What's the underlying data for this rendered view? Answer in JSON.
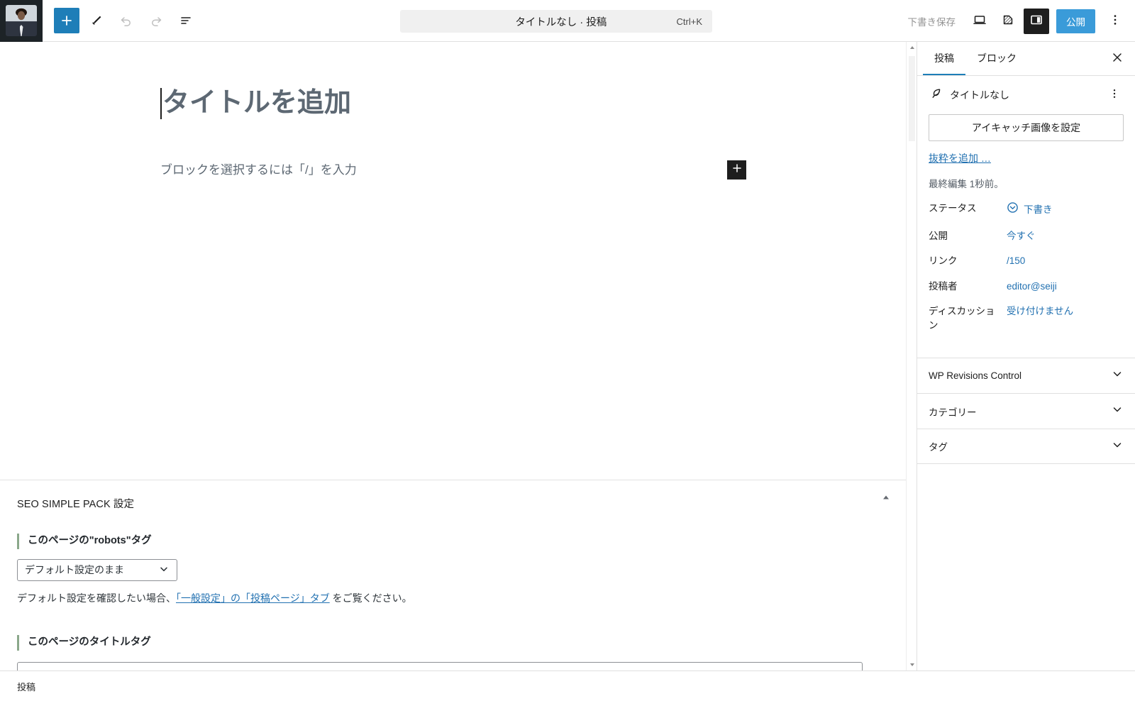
{
  "topbar": {
    "site_icon_name": "site-avatar-photo",
    "tools": [
      {
        "name": "block-inserter-toggle",
        "label": "ブロック挿入ツールを切り替え",
        "icon": "plus-icon",
        "state": "primary"
      },
      {
        "name": "edit-mode-tool",
        "label": "ツール",
        "icon": "pencil-icon",
        "state": "normal"
      },
      {
        "name": "undo-button",
        "label": "元に戻す",
        "icon": "undo-icon",
        "state": "disabled"
      },
      {
        "name": "redo-button",
        "label": "やり直す",
        "icon": "redo-icon",
        "state": "disabled"
      },
      {
        "name": "document-overview-button",
        "label": "ドキュメント概観",
        "icon": "list-view-icon",
        "state": "normal"
      }
    ],
    "command_bar": {
      "title": "タイトルなし · 投稿",
      "shortcut": "Ctrl+K"
    },
    "save_draft_label": "下書き保存",
    "right_tools": [
      {
        "name": "preview-button",
        "label": "プレビュー",
        "icon": "desktop-icon",
        "state": "normal"
      },
      {
        "name": "view-post-button",
        "label": "投稿を表示",
        "icon": "external-page-icon",
        "state": "normal"
      },
      {
        "name": "settings-sidebar-toggle",
        "label": "設定",
        "icon": "sidebar-panel-icon",
        "state": "active"
      }
    ],
    "publish_label": "公開",
    "options_label": "オプション",
    "options_icon": "three-dots-vertical-icon",
    "accent_color": "#1e7eb8",
    "publish_color": "#3a9bd9"
  },
  "editor": {
    "title_placeholder": "タイトルを追加",
    "block_placeholder": "ブロックを選択するには「/」を入力",
    "inserter_icon": "plus-icon"
  },
  "seo_box": {
    "title": "SEO SIMPLE PACK 設定",
    "collapse_icon": "triangle-up-icon",
    "robots_field": {
      "label_prefix": "このページの",
      "label_code": "\"robots\"",
      "label_suffix": "タグ",
      "select_value": "デフォルト設定のまま",
      "select_icon": "chevron-down-icon",
      "help_before": "デフォルト設定を確認したい場合、",
      "help_link": "「一般設定」の「投稿ページ」タブ",
      "help_after": " をご覧ください。"
    },
    "title_tag_field": {
      "label": "このページのタイトルタグ",
      "input_value": ""
    }
  },
  "scrollbar": {
    "up_icon": "triangle-up-icon",
    "down_icon": "triangle-down-icon"
  },
  "sidebar": {
    "tabs": [
      {
        "label": "投稿",
        "name": "tab-post",
        "selected": true
      },
      {
        "label": "ブロック",
        "name": "tab-block",
        "selected": false
      }
    ],
    "close_icon": "close-icon",
    "summary": {
      "post_icon": "feather-post-icon",
      "post_title": "タイトルなし",
      "more_icon": "three-dots-vertical-icon",
      "featured_image_label": "アイキャッチ画像を設定",
      "excerpt_link": "抜粋を追加 …",
      "last_edited": "最終編集 1秒前。"
    },
    "meta_rows": [
      {
        "name": "status-row",
        "label": "ステータス",
        "value": "下書き",
        "icon": "draft-circle-icon"
      },
      {
        "name": "publish-row",
        "label": "公開",
        "value": "今すぐ",
        "icon": ""
      },
      {
        "name": "link-row",
        "label": "リンク",
        "value": "/150",
        "icon": ""
      },
      {
        "name": "author-row",
        "label": "投稿者",
        "value": "editor@seiji",
        "icon": ""
      },
      {
        "name": "discussion-row",
        "label": "ディスカッション",
        "value": "受け付けません",
        "icon": ""
      }
    ],
    "panels": [
      {
        "name": "panel-wp-revisions-control",
        "title": "WP Revisions Control",
        "icon": "chevron-down-icon"
      },
      {
        "name": "panel-categories",
        "title": "カテゴリー",
        "icon": "chevron-down-icon"
      },
      {
        "name": "panel-tags",
        "title": "タグ",
        "icon": "chevron-down-icon"
      }
    ]
  },
  "statusbar": {
    "label": "投稿"
  }
}
